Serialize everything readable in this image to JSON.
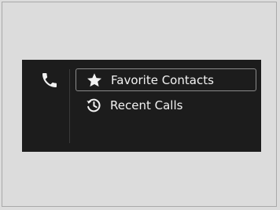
{
  "phone_menu": {
    "header_icon": "phone-icon",
    "items": [
      {
        "label": "Favorite Contacts",
        "icon": "star-icon",
        "selected": true
      },
      {
        "label": "Recent Calls",
        "icon": "history-clock-icon",
        "selected": false
      }
    ]
  },
  "colors": {
    "screen_background": "#1c1c1c",
    "text": "#f2f2f2",
    "selection_border": "#8a8a8a",
    "page_background": "#dcdcdc"
  }
}
